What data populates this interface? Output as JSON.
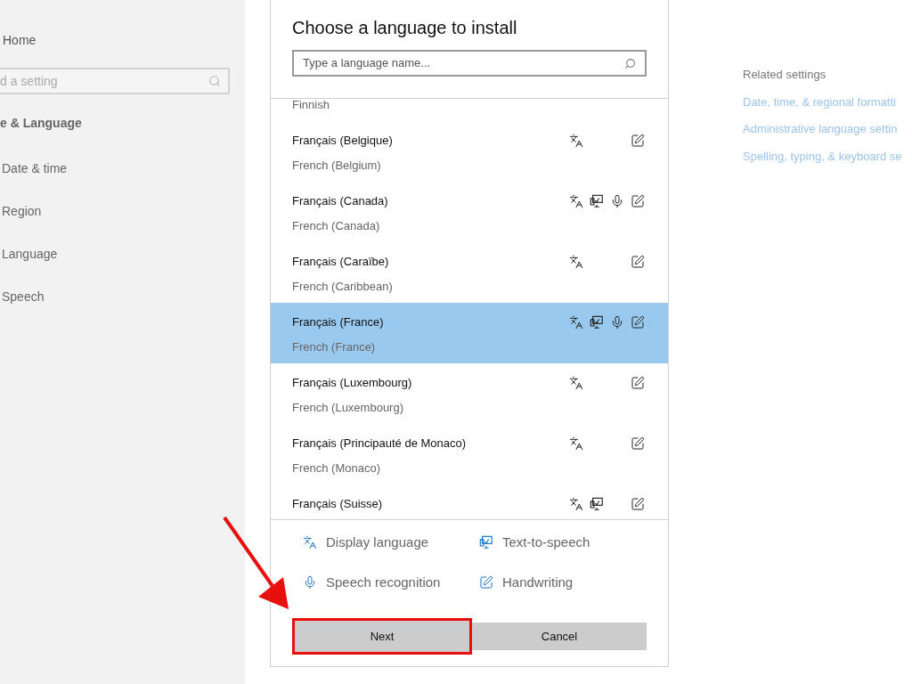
{
  "sidebar": {
    "home": "Home",
    "search": {
      "placeholder": "d a setting"
    },
    "section_title": "e & Language",
    "items": [
      {
        "label": "Date & time"
      },
      {
        "label": "Region"
      },
      {
        "label": "Language"
      },
      {
        "label": "Speech"
      }
    ]
  },
  "related_settings": {
    "title": "Related settings",
    "links": [
      "Date, time, & regional formatti",
      "Administrative language settin",
      "Spelling, typing, & keyboard se"
    ]
  },
  "dialog": {
    "title": "Choose a language to install",
    "search": {
      "placeholder": "Type a language name..."
    },
    "languages": [
      {
        "subtitle": "Finnish",
        "selected": false
      },
      {
        "name": "Français (Belgique)",
        "subtitle": "French (Belgium)",
        "selected": false,
        "display": true,
        "tts": false,
        "speech": false,
        "handwriting": true
      },
      {
        "name": "Français (Canada)",
        "subtitle": "French (Canada)",
        "selected": false,
        "display": true,
        "tts": true,
        "speech": true,
        "handwriting": true
      },
      {
        "name": "Français (Caraïbe)",
        "subtitle": "French (Caribbean)",
        "selected": false,
        "display": true,
        "tts": false,
        "speech": false,
        "handwriting": true
      },
      {
        "name": "Français (France)",
        "subtitle": "French (France)",
        "selected": true,
        "display": true,
        "tts": true,
        "speech": true,
        "handwriting": true
      },
      {
        "name": "Français (Luxembourg)",
        "subtitle": "French (Luxembourg)",
        "selected": false,
        "display": true,
        "tts": false,
        "speech": false,
        "handwriting": true
      },
      {
        "name": "Français (Principauté de Monaco)",
        "subtitle": "French (Monaco)",
        "selected": false,
        "display": true,
        "tts": false,
        "speech": false,
        "handwriting": true
      },
      {
        "name": "Français (Suisse)",
        "selected": false,
        "display": true,
        "tts": true,
        "speech": false,
        "handwriting": true
      }
    ],
    "legend": [
      {
        "kind": "display",
        "label": "Display language"
      },
      {
        "kind": "tts",
        "label": "Text-to-speech"
      },
      {
        "kind": "speech",
        "label": "Speech recognition"
      },
      {
        "kind": "handwriting",
        "label": "Handwriting"
      }
    ],
    "buttons": [
      {
        "label": "Next",
        "highlighted": true
      },
      {
        "label": "Cancel",
        "highlighted": false
      }
    ]
  }
}
